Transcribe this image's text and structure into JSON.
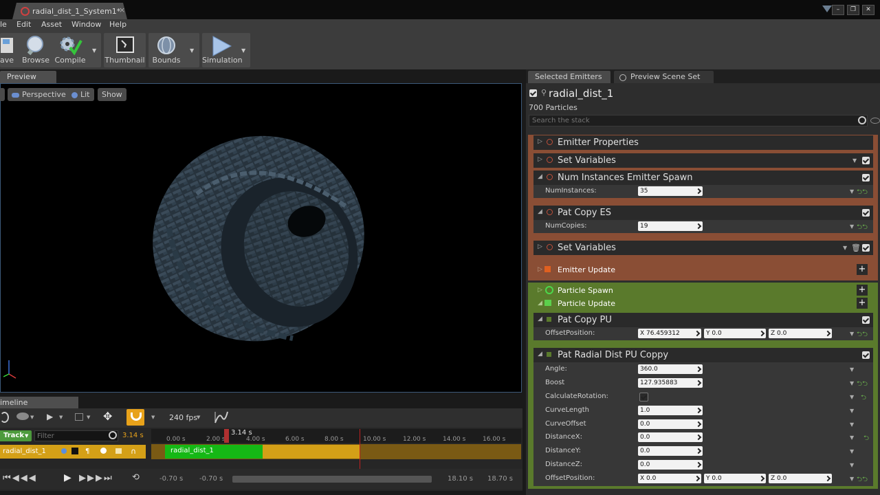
{
  "window": {
    "tab_title": "radial_dist_1_System1*",
    "close_glyph": "×"
  },
  "menu": [
    "le",
    "Edit",
    "Asset",
    "Window",
    "Help"
  ],
  "toolbar": {
    "save": "ave",
    "browse": "Browse",
    "compile": "Compile",
    "thumbnail": "Thumbnail",
    "bounds": "Bounds",
    "simulation": "Simulation"
  },
  "viewport": {
    "tab": "Preview",
    "perspective": "Perspective",
    "lit": "Lit",
    "show": "Show"
  },
  "timeline": {
    "tab": "imeline",
    "fps": "240 fps",
    "track_btn": "Track",
    "filter_placeholder": "Filter",
    "current_time_left": "3.14 s",
    "playhead_label": "3.14 s",
    "ticks": [
      "0.00 s",
      "2.00 s",
      "4.00 s",
      "6.00 s",
      "8.00 s",
      "10.00 s",
      "12.00 s",
      "14.00 s",
      "16.00 s"
    ],
    "track_name": "radial_dist_1",
    "bar_label": "radial_dist_1",
    "range_start_a": "-0.70 s",
    "range_start_b": "-0.70 s",
    "range_end_a": "18.10 s",
    "range_end_b": "18.70 s"
  },
  "right": {
    "tab_selected": "Selected Emitters",
    "tab_preview": "Preview Scene Set",
    "emitter_name": "radial_dist_1",
    "particles": "700 Particles",
    "search_placeholder": "Search the stack",
    "emitter_properties": "Emitter Properties",
    "set_variables_1": "Set Variables",
    "num_instances": "Num Instances Emitter Spawn",
    "num_instances_label": "NumInstances:",
    "num_instances_value": "35",
    "pat_copy_es": "Pat Copy ES",
    "num_copies_label": "NumCopies:",
    "num_copies_value": "19",
    "set_variables_2": "Set Variables",
    "emitter_update": "Emitter Update",
    "particle_spawn": "Particle Spawn",
    "particle_update": "Particle Update",
    "pat_copy_pu": "Pat Copy PU",
    "offset_label": "OffsetPosition:",
    "offset_x": "X 76.459312",
    "offset_y": "Y 0.0",
    "offset_z": "Z 0.0",
    "radial": "Pat Radial Dist PU Coppy",
    "props": [
      {
        "label": "Angle:",
        "value": "360.0"
      },
      {
        "label": "Boost",
        "value": "127.935883"
      },
      {
        "label": "CalculateRotation:",
        "value": ""
      },
      {
        "label": "CurveLength",
        "value": "1.0"
      },
      {
        "label": "CurveOffset",
        "value": "0.0"
      },
      {
        "label": "DistanceX:",
        "value": "0.0"
      },
      {
        "label": "DistanceY:",
        "value": "0.0"
      },
      {
        "label": "DistanceZ:",
        "value": "0.0"
      }
    ],
    "offset2_label": "OffsetPosition:",
    "offset2_x": "X 0.0",
    "offset2_y": "Y 0.0",
    "offset2_z": "Z 0.0"
  },
  "colors": {
    "accent_orange": "#e8a21a",
    "emitter_band": "#8a4e35",
    "particle_band": "#5a7a2c",
    "track_green": "#15b815",
    "track_gold": "#d4a017"
  }
}
